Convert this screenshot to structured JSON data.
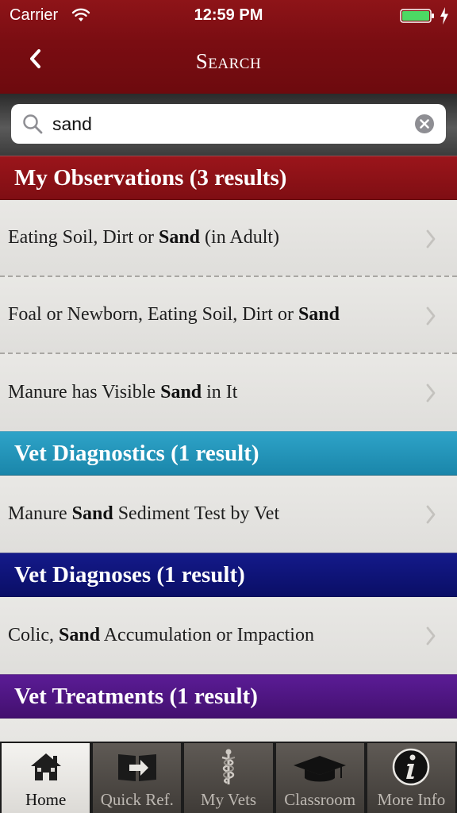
{
  "status_bar": {
    "carrier": "Carrier",
    "time": "12:59 PM"
  },
  "nav": {
    "title": "Search",
    "back_icon": "chevron-left-icon"
  },
  "search": {
    "value": "sand",
    "icons": [
      "search-icon",
      "clear-icon"
    ]
  },
  "sections": [
    {
      "title": "My Observations (3 results)",
      "color": "#8a1116",
      "items": [
        {
          "pre": "Eating Soil, Dirt or ",
          "match": "Sand",
          "post": " (in Adult)"
        },
        {
          "pre": "Foal or Newborn, Eating Soil, Dirt or ",
          "match": "Sand",
          "post": ""
        },
        {
          "pre": "Manure has Visible ",
          "match": "Sand",
          "post": " in It"
        }
      ]
    },
    {
      "title": "Vet Diagnostics (1 result)",
      "color": "#2394b9",
      "items": [
        {
          "pre": "Manure ",
          "match": "Sand",
          "post": " Sediment Test by Vet"
        }
      ]
    },
    {
      "title": "Vet Diagnoses (1 result)",
      "color": "#0f1478",
      "items": [
        {
          "pre": "Colic, ",
          "match": "Sand",
          "post": " Accumulation or Impaction"
        }
      ]
    },
    {
      "title": "Vet Treatments (1 result)",
      "color": "#4e1684",
      "items": []
    }
  ],
  "tabs": [
    {
      "label": "Home",
      "icon": "home-icon",
      "active": true
    },
    {
      "label": "Quick Ref.",
      "icon": "book-arrow-icon",
      "active": false
    },
    {
      "label": "My Vets",
      "icon": "caduceus-icon",
      "active": false
    },
    {
      "label": "Classroom",
      "icon": "graduation-cap-icon",
      "active": false
    },
    {
      "label": "More Info",
      "icon": "info-icon",
      "active": false
    }
  ],
  "colors": {
    "header": "#7a0d12",
    "battery": "#4cd964"
  }
}
